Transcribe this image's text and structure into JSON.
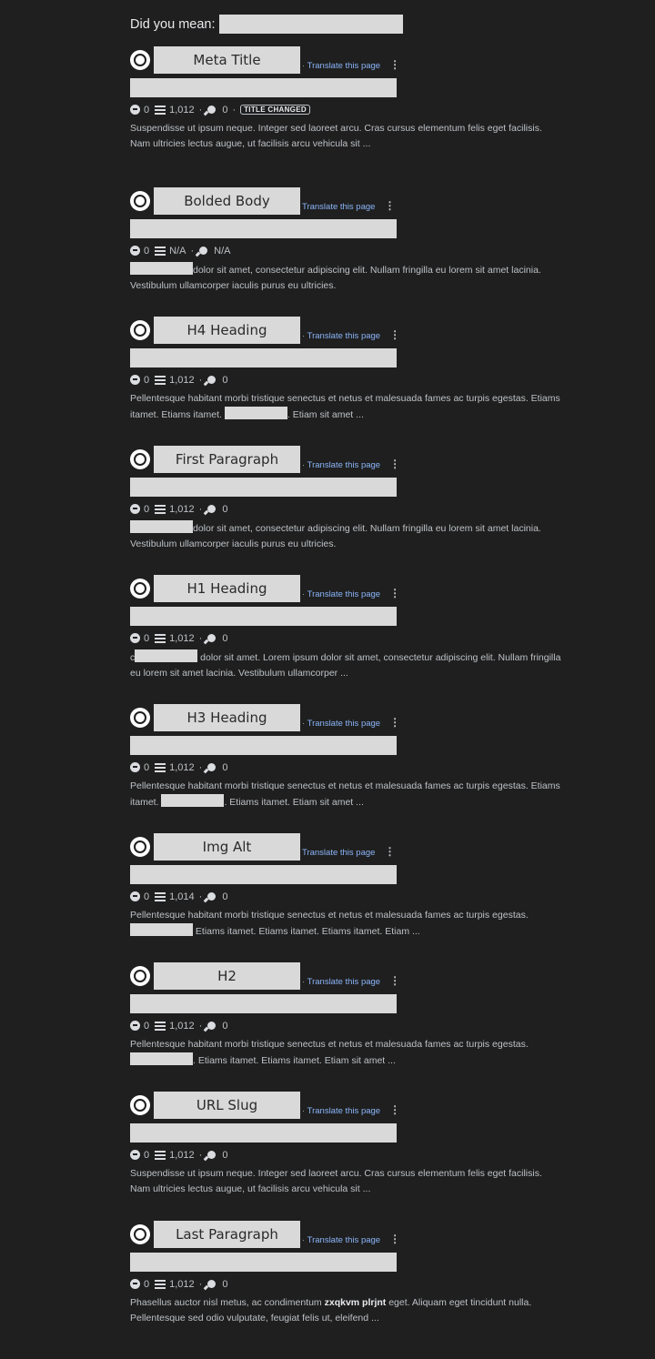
{
  "did_you_mean": {
    "label": "Did you mean:"
  },
  "translate_label": "Translate this page",
  "colors": {
    "background": "#1f1f1f",
    "link": "#8ab4f8",
    "redaction": "#d9d9d9"
  },
  "results": [
    {
      "title": "Meta Title",
      "sep": true,
      "comments": "0",
      "words": "1,012",
      "keywords": "0",
      "badge": "TITLE CHANGED",
      "snippet": [
        {
          "t": "Suspendisse ut ipsum neque. Integer sed laoreet arcu. Cras cursus elementum felis eget facilisis. Nam ultricies lectus augue, ut facilisis arcu vehicula sit ..."
        }
      ]
    },
    {
      "title": "Bolded Body",
      "sep": false,
      "comments": "0",
      "words": "N/A",
      "keywords": "N/A",
      "snippet": [
        {
          "r": true
        },
        {
          "t": "dolor sit amet, consectetur adipiscing elit. Nullam fringilla eu lorem sit amet lacinia. Vestibulum ullamcorper iaculis purus eu ultricies."
        }
      ]
    },
    {
      "title": "H4 Heading",
      "sep": true,
      "comments": "0",
      "words": "1,012",
      "keywords": "0",
      "snippet": [
        {
          "t": "Pellentesque habitant morbi tristique senectus et netus et malesuada fames ac turpis egestas. Etiams itamet. Etiams itamet. "
        },
        {
          "r": true
        },
        {
          "t": ". Etiam sit amet ..."
        }
      ]
    },
    {
      "title": "First Paragraph",
      "sep": true,
      "comments": "0",
      "words": "1,012",
      "keywords": "0",
      "snippet": [
        {
          "r": true
        },
        {
          "t": "dolor sit amet, consectetur adipiscing elit. Nullam fringilla eu lorem sit amet lacinia. Vestibulum ullamcorper iaculis purus eu ultricies."
        }
      ]
    },
    {
      "title": "H1 Heading",
      "sep": true,
      "comments": "0",
      "words": "1,012",
      "keywords": "0",
      "snippet": [
        {
          "t": "c"
        },
        {
          "r": true
        },
        {
          "t": " dolor sit amet. Lorem ipsum dolor sit amet, consectetur adipiscing elit. Nullam fringilla eu lorem sit amet lacinia. Vestibulum ullamcorper ..."
        }
      ]
    },
    {
      "title": "H3 Heading",
      "sep": true,
      "comments": "0",
      "words": "1,012",
      "keywords": "0",
      "snippet": [
        {
          "t": "Pellentesque habitant morbi tristique senectus et netus et malesuada fames ac turpis egestas. Etiams itamet. "
        },
        {
          "r": true
        },
        {
          "t": ". Etiams itamet. Etiam sit amet ..."
        }
      ]
    },
    {
      "title": "Img Alt",
      "sep": false,
      "comments": "0",
      "words": "1,014",
      "keywords": "0",
      "snippet": [
        {
          "t": "Pellentesque habitant morbi tristique senectus et netus et malesuada fames ac turpis egestas. "
        },
        {
          "r": true
        },
        {
          "t": " Etiams itamet. Etiams itamet. Etiams itamet. Etiam ..."
        }
      ]
    },
    {
      "title": "H2",
      "sep": true,
      "comments": "0",
      "words": "1,012",
      "keywords": "0",
      "snippet": [
        {
          "t": "Pellentesque habitant morbi tristique senectus et netus et malesuada fames ac turpis egestas. "
        },
        {
          "r": true
        },
        {
          "t": ". Etiams itamet. Etiams itamet. Etiam sit amet ..."
        }
      ]
    },
    {
      "title": "URL Slug",
      "sep": true,
      "comments": "0",
      "words": "1,012",
      "keywords": "0",
      "snippet": [
        {
          "t": "Suspendisse ut ipsum neque. Integer sed laoreet arcu. Cras cursus elementum felis eget facilisis. Nam ultricies lectus augue, ut facilisis arcu vehicula sit ..."
        }
      ]
    },
    {
      "title": "Last Paragraph",
      "sep": true,
      "comments": "0",
      "words": "1,012",
      "keywords": "0",
      "snippet": [
        {
          "t": "Phasellus auctor nisl metus, ac condimentum "
        },
        {
          "t": "zxqkvm plrjnt",
          "b": true
        },
        {
          "t": " eget. Aliquam eget tincidunt nulla. Pellentesque sed odio vulputate, feugiat felis ut, eleifend ..."
        }
      ]
    }
  ]
}
